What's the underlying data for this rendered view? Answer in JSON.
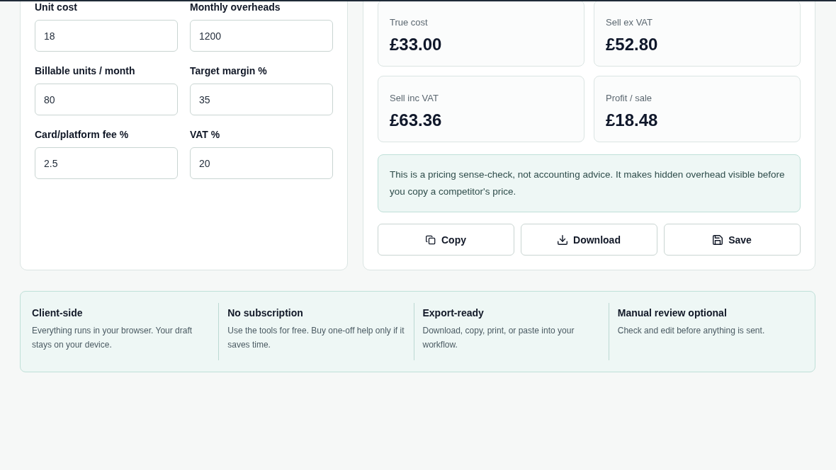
{
  "calculator": {
    "fields": [
      {
        "label": "Unit cost",
        "value": "18"
      },
      {
        "label": "Monthly overheads",
        "value": "1200"
      },
      {
        "label": "Billable units / month",
        "value": "80"
      },
      {
        "label": "Target margin %",
        "value": "35"
      },
      {
        "label": "Card/platform fee %",
        "value": "2.5"
      },
      {
        "label": "VAT %",
        "value": "20"
      }
    ]
  },
  "results": {
    "stats": [
      {
        "label": "True cost",
        "value": "£33.00"
      },
      {
        "label": "Sell ex VAT",
        "value": "£52.80"
      },
      {
        "label": "Sell inc VAT",
        "value": "£63.36"
      },
      {
        "label": "Profit / sale",
        "value": "£18.48"
      }
    ],
    "note": "This is a pricing sense-check, not accounting advice. It makes hidden overhead visible before you copy a competitor's price.",
    "actions": [
      {
        "kind": "copy",
        "label": "Copy"
      },
      {
        "kind": "download",
        "label": "Download"
      },
      {
        "kind": "save",
        "label": "Save"
      }
    ]
  },
  "features": [
    {
      "title": "Client-side",
      "text": "Everything runs in your browser. Your draft stays on your device."
    },
    {
      "title": "No subscription",
      "text": "Use the tools for free. Buy one-off help only if it saves time."
    },
    {
      "title": "Export-ready",
      "text": "Download, copy, print, or paste into your workflow."
    },
    {
      "title": "Manual review optional",
      "text": "Check and edit before anything is sent."
    }
  ]
}
